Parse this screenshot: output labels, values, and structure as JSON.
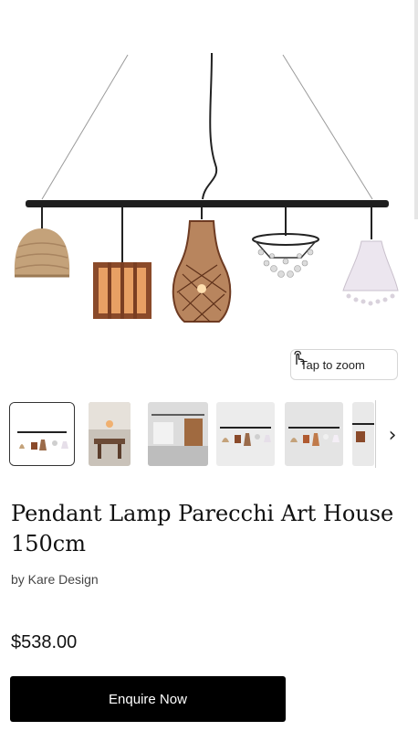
{
  "product": {
    "title": "Pendant Lamp Parecchi Art House 150cm",
    "brand": "by Kare Design",
    "price": "$538.00",
    "enquire_label": "Enquire Now"
  },
  "gallery": {
    "zoom_label": "Tap to zoom",
    "zoom_icon": "tap-hand-icon",
    "next_icon": "chevron-right-icon",
    "next_glyph": "›",
    "selected_index": 0,
    "thumbnail_count": 6
  },
  "colors": {
    "button_bg": "#000000",
    "button_text": "#ffffff",
    "selected_thumb_border": "#333333"
  }
}
